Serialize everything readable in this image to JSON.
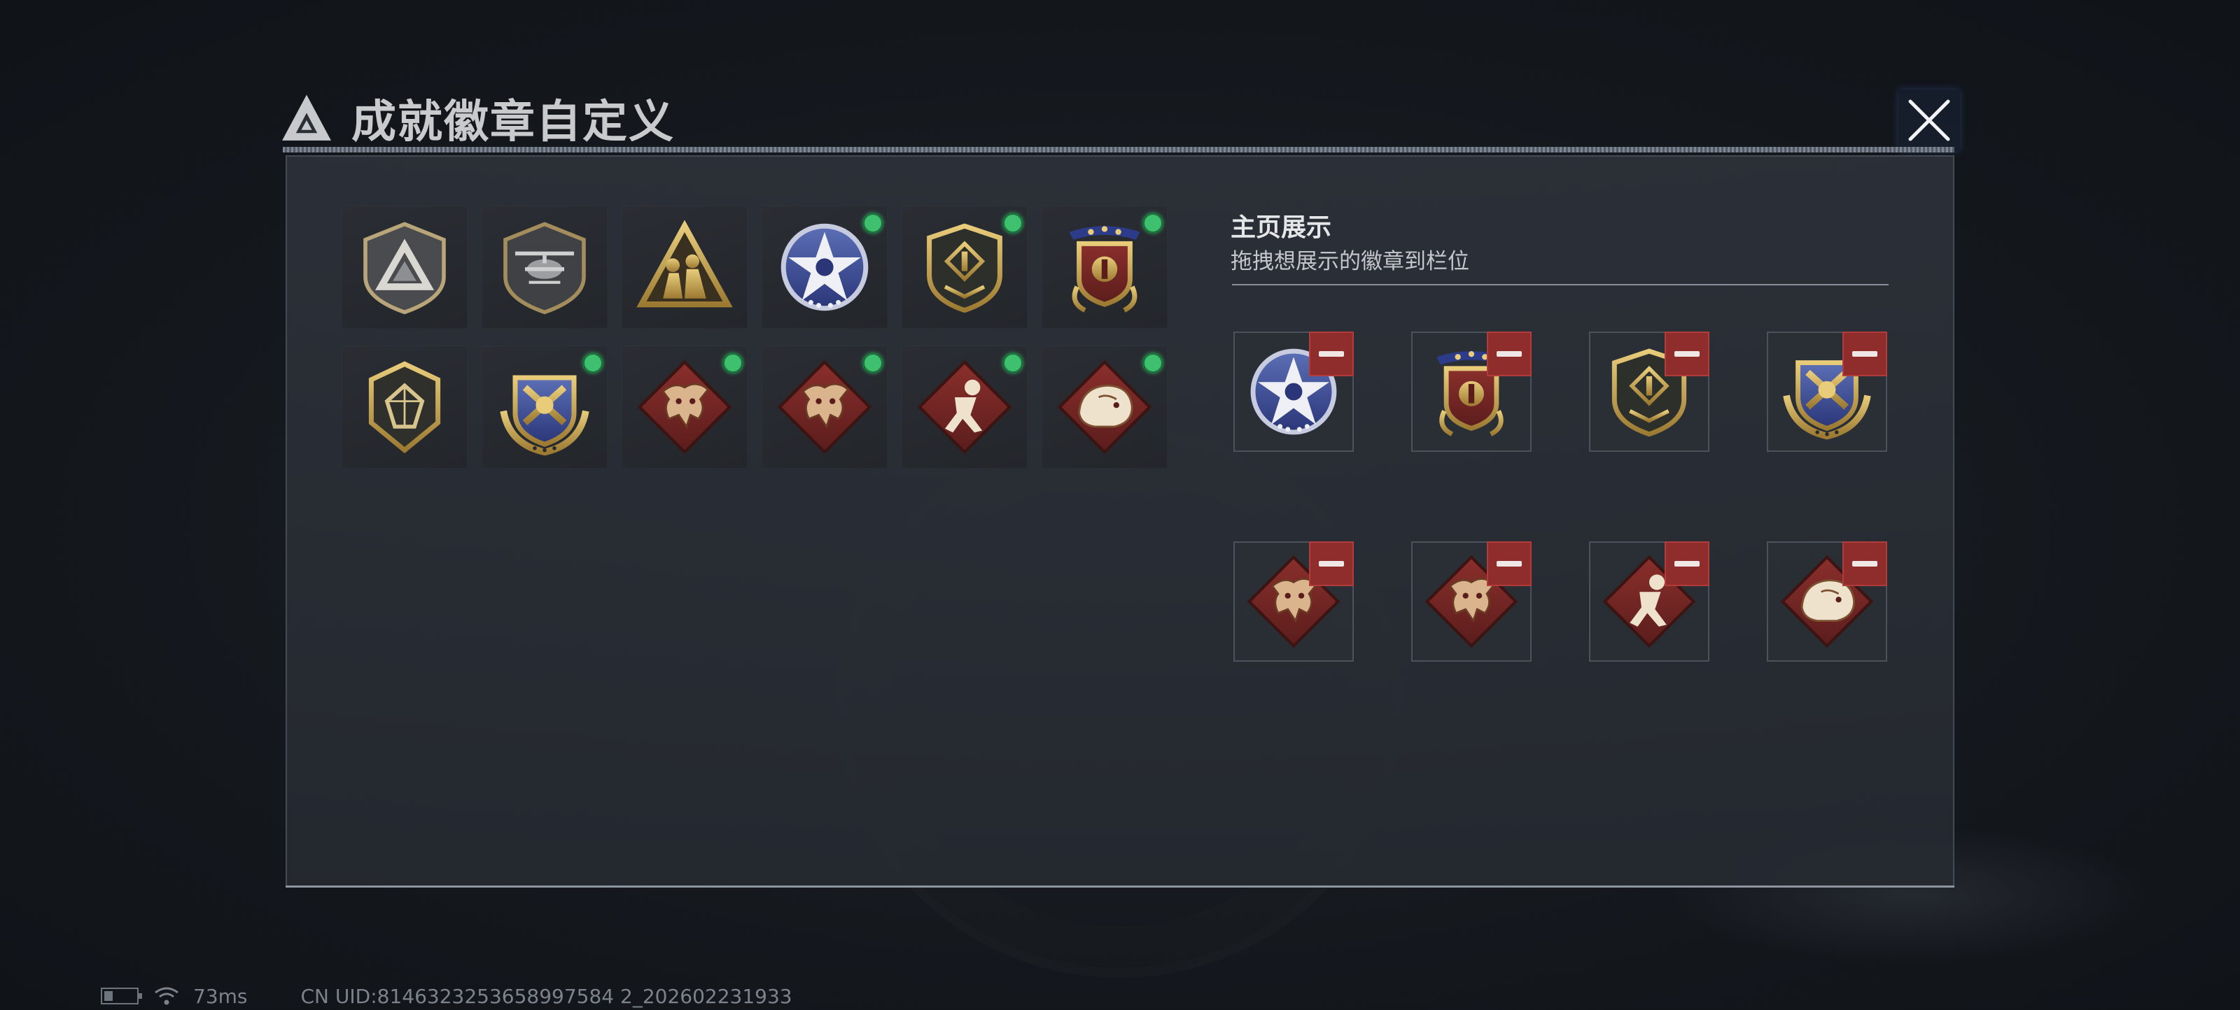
{
  "dialog": {
    "title": "成就徽章自定义",
    "close_label": "close"
  },
  "showcase": {
    "title": "主页展示",
    "subtitle": "拖拽想展示的徽章到栏位"
  },
  "badges": [
    {
      "icon": "gray-triangle-shield-icon",
      "equipped": false
    },
    {
      "icon": "helicopter-shield-icon",
      "equipped": false
    },
    {
      "icon": "gold-soldiers-triangle-icon",
      "equipped": false
    },
    {
      "icon": "blue-star-badge-icon",
      "equipped": true
    },
    {
      "icon": "dark-shield-emblem-icon",
      "equipped": true
    },
    {
      "icon": "red-gold-stars-emblem-icon",
      "equipped": true
    },
    {
      "icon": "dark-gem-shield-icon",
      "equipped": false
    },
    {
      "icon": "gold-wings-crest-icon",
      "equipped": true
    },
    {
      "icon": "red-dragon-diamond-icon",
      "equipped": true
    },
    {
      "icon": "red-dragon-diamond-icon-2",
      "equipped": true
    },
    {
      "icon": "red-soldier-diamond-icon",
      "equipped": true
    },
    {
      "icon": "red-beast-diamond-icon",
      "equipped": true
    }
  ],
  "slots": [
    {
      "icon": "blue-star-badge-icon"
    },
    {
      "icon": "red-gold-stars-emblem-icon"
    },
    {
      "icon": "dark-shield-emblem-icon"
    },
    {
      "icon": "gold-wings-crest-icon"
    },
    {
      "icon": "red-dragon-diamond-icon"
    },
    {
      "icon": "red-dragon-diamond-icon-2"
    },
    {
      "icon": "red-soldier-diamond-icon"
    },
    {
      "icon": "red-beast-diamond-icon"
    }
  ],
  "status": {
    "latency": "73ms",
    "uid": "CN UID:8146323253658997584 2_202602231933"
  },
  "colors": {
    "equipped_dot": "#3ec06e",
    "remove_button": "#8f2c2c",
    "gold": "#c9a24a"
  }
}
